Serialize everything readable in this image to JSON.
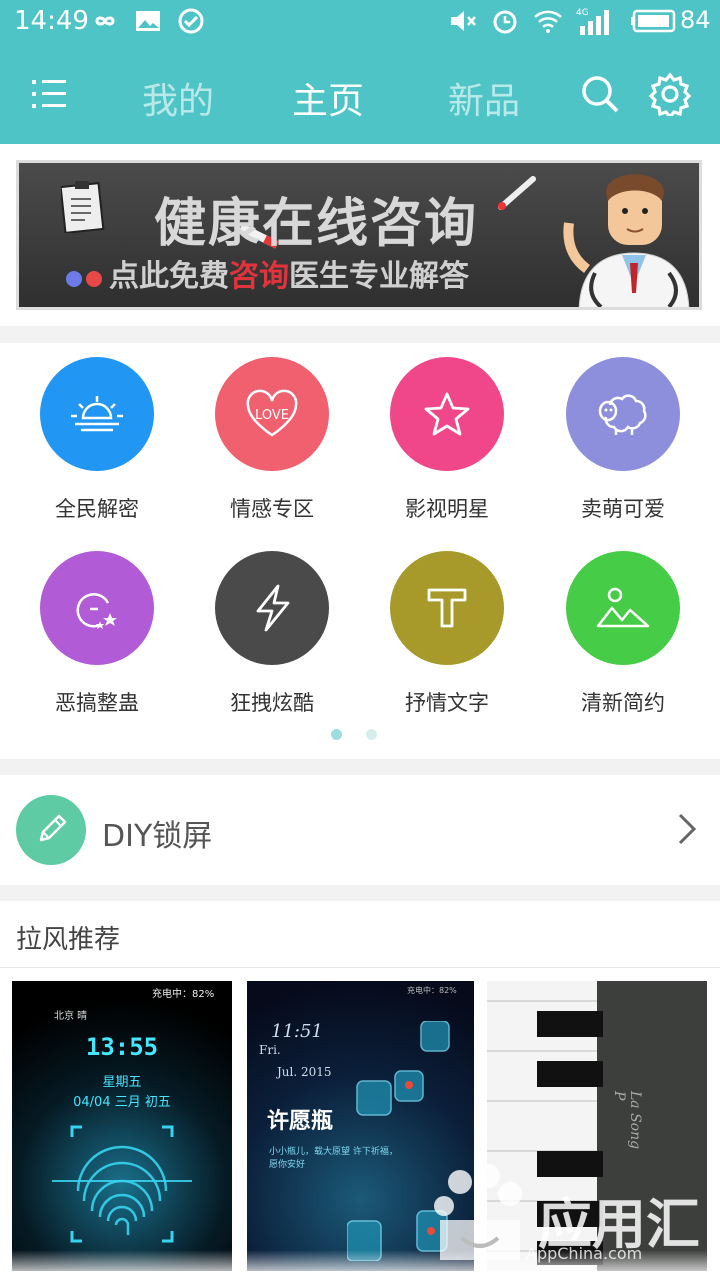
{
  "status_bar": {
    "time": "14:49",
    "battery": "84",
    "network": "4G"
  },
  "nav": {
    "tabs": [
      {
        "label": "我的",
        "active": false
      },
      {
        "label": "主页",
        "active": true
      },
      {
        "label": "新品",
        "active": false
      }
    ],
    "menu_icon": "menu-icon",
    "search_icon": "search-icon",
    "settings_icon": "gear-icon",
    "color": "#4fc4c6"
  },
  "banner": {
    "title": "健康在线咨询",
    "subtitle_before": "点此免费",
    "subtitle_highlight": "咨询",
    "subtitle_after": "医生专业解答"
  },
  "categories": [
    {
      "label": "全民解密",
      "icon": "sunrise-icon",
      "color": "#2196f3"
    },
    {
      "label": "情感专区",
      "icon": "love-heart-icon",
      "color": "#f0606e"
    },
    {
      "label": "影视明星",
      "icon": "star-icon",
      "color": "#f0478a"
    },
    {
      "label": "卖萌可爱",
      "icon": "sheep-icon",
      "color": "#8e8fdc"
    },
    {
      "label": "恶搞整蛊",
      "icon": "prank-icon",
      "color": "#b25bd6"
    },
    {
      "label": "狂拽炫酷",
      "icon": "lightning-icon",
      "color": "#4a4a4a"
    },
    {
      "label": "抒情文字",
      "icon": "text-t-icon",
      "color": "#a79a2a"
    },
    {
      "label": "清新简约",
      "icon": "mountain-icon",
      "color": "#46cc46"
    }
  ],
  "pager": {
    "pages": 2,
    "current": 1,
    "active_color": "#9edddd",
    "inactive_color": "#d8eeee"
  },
  "diy": {
    "label": "DIY锁屏",
    "icon": "pencil-icon"
  },
  "recommend": {
    "title": "拉风推荐",
    "thumb1": {
      "status": "充电中：82%",
      "weather": "北京 晴",
      "time": "13:55",
      "line1": "星期五",
      "line2": "04/04  三月 初五"
    },
    "thumb2": {
      "status": "充电中：82%",
      "time": "11:51",
      "day": "Fri.",
      "date": "Jul. 2015",
      "title": "许愿瓶",
      "lines": "小小瓶儿，载大原望 许下祈福，愿你安好"
    },
    "thumb3": {
      "brand": "La Song P"
    }
  },
  "watermark": {
    "text": "应用汇",
    "sub": "AppChina.com"
  }
}
